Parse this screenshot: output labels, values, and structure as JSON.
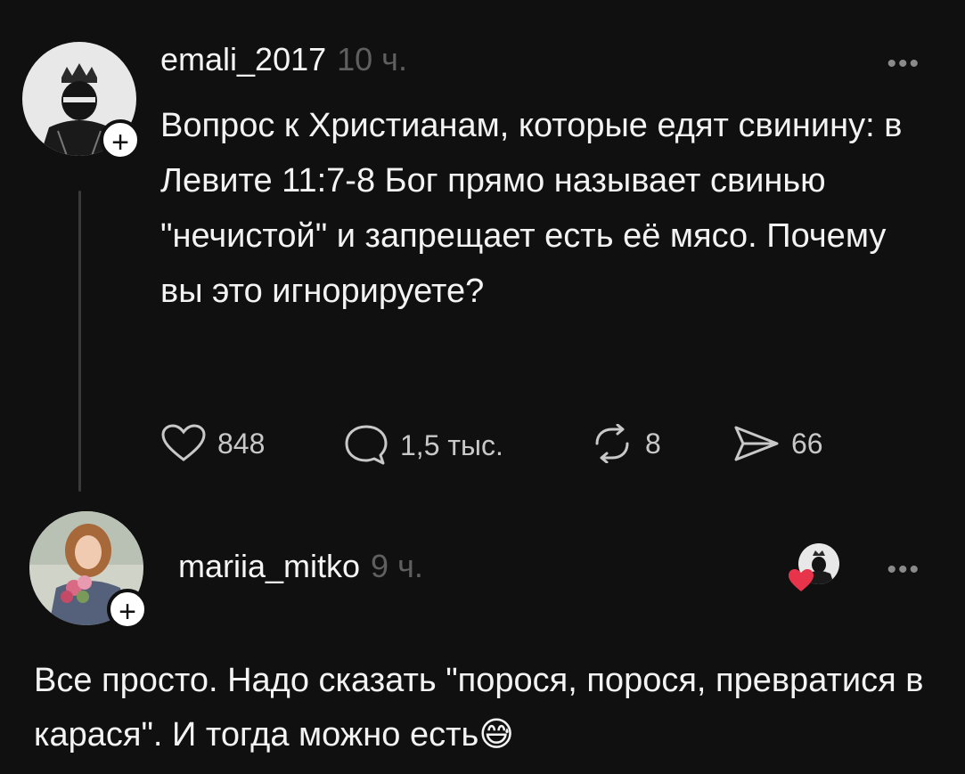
{
  "post": {
    "username": "emali_2017",
    "time": "10 ч.",
    "text": "Вопрос к Христианам, которые едят свинину: в Левите 11:7-8 Бог прямо называет свинью \"нечистой\" и запрещает есть её мясо. Почему вы это игнорируете?",
    "likes": "848",
    "comments": "1,5 тыс.",
    "reposts": "8",
    "shares": "66",
    "more_label": "•••"
  },
  "reply": {
    "username": "mariia_mitko",
    "time": "9 ч.",
    "text": "Все просто. Надо сказать \"порося, порося, превратися в карася\". И тогда можно есть",
    "emoji": "😅",
    "more_label": "•••"
  },
  "icons": {
    "post_avatar": "masked-figure-with-crown-avatar",
    "reply_avatar": "woman-with-bouquet-avatar",
    "follow": "plus-icon",
    "like": "heart-outline-icon",
    "comment": "speech-bubble-icon",
    "repost": "repost-arrows-icon",
    "share": "paper-plane-icon",
    "liked_by_author": "red-heart-icon"
  },
  "colors": {
    "background": "#101010",
    "muted_text": "#5f5f5f",
    "liked_heart": "#e8344a"
  }
}
